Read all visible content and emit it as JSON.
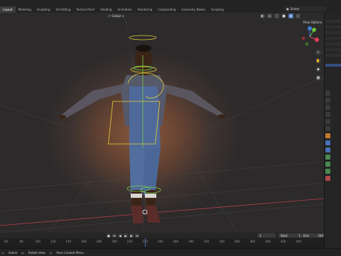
{
  "workspace_tabs": [
    "Layout",
    "Modeling",
    "Sculpting",
    "UV Editing",
    "Texture Paint",
    "Shading",
    "Animation",
    "Rendering",
    "Compositing",
    "Geometry Nodes",
    "Scripting"
  ],
  "active_tab": "Layout",
  "scene": {
    "label": "Scene"
  },
  "viewport": {
    "orientation_label": "Global",
    "pose_options_label": "Pose Options"
  },
  "timeline": {
    "current_frame": "1",
    "start_label": "Start",
    "start_value": "1",
    "end_label": "End",
    "end_value": "250"
  },
  "ruler_ticks": [
    "60",
    "80",
    "100",
    "120",
    "140",
    "160",
    "180",
    "200",
    "220",
    "240",
    "260",
    "280",
    "300",
    "320",
    "340",
    "360",
    "380",
    "400",
    "420",
    "440"
  ],
  "statusbar": {
    "left_label": "Select",
    "middle_label": "Rotate View",
    "right_label": "Pose Context Menu"
  },
  "icons": {
    "gizmo_x": "#e0405a",
    "gizmo_y": "#6bbf3b",
    "gizmo_z": "#3d7fdc",
    "accent": "#4772b3",
    "bone_yellow": "#e8d23a",
    "bone_green": "#7bd04a"
  }
}
